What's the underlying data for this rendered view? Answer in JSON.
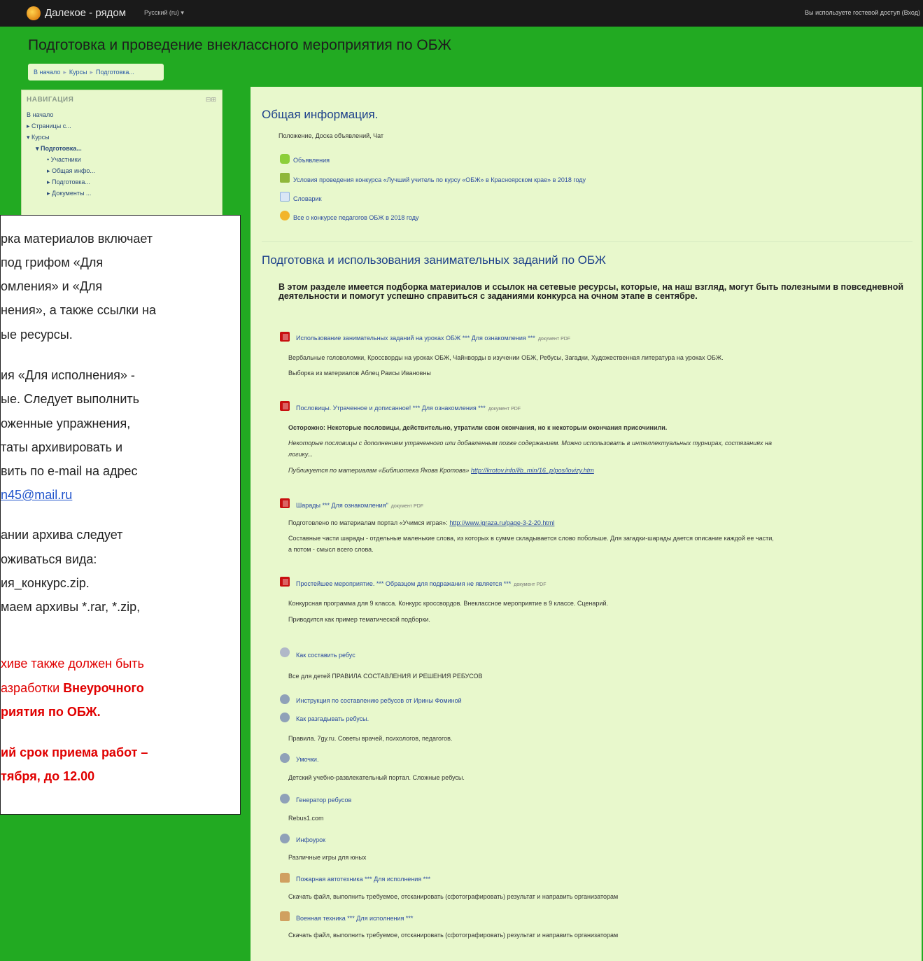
{
  "topbar": {
    "site_name": "Далекое - рядом",
    "language": "Русский (ru) ▾",
    "guest_notice": "Вы используете гостевой доступ (Вход)"
  },
  "header": {
    "title": "Подготовка и проведение внеклассного мероприятия по ОБЖ",
    "breadcrumb": [
      "В начало",
      "Курсы",
      "Подготовка..."
    ]
  },
  "nav": {
    "heading": "НАВИГАЦИЯ",
    "control": "⊟⊞",
    "items": [
      "В начало",
      "▸ Страницы с...",
      "▾ Курсы",
      "▾ Подготовка...",
      "• Участники",
      "▸ Общая инфо...",
      "▸ Подготовка...",
      "▸ Документы ..."
    ]
  },
  "section1": {
    "title": "Общая информация.",
    "summary": "Положение, Доска объявлений, Чат",
    "links": [
      {
        "label": "Объявления",
        "icon": "forum-icon"
      },
      {
        "label": "Условия проведения конкурса «Лучший учитель по курсу «ОБЖ» в Красноярском крае» в 2018 году",
        "icon": "book-icon"
      },
      {
        "label": "Словарик",
        "icon": "glossary-icon"
      },
      {
        "label": "Все о конкурсе педагогов ОБЖ в 2018 году",
        "icon": "chat-icon"
      }
    ]
  },
  "section2": {
    "title": "Подготовка и использования занимательных заданий по ОБЖ",
    "description": "В этом разделе имеется подборка материалов и ссылок на сетевые ресурсы, которые, на наш взгляд, могут быть полезными в повседневной деятельности и помогут успешно справиться с заданиями конкурса на очном этапе в сентябре.",
    "resources": [
      {
        "label": "Использование занимательных заданий на уроках ОБЖ *** Для ознакомления ***",
        "type": "документ PDF",
        "lines": [
          "Вербальные головоломки, Кроссворды на уроках ОБЖ, Чайнворды в изучении ОБЖ, Ребусы, Загадки, Художественная литература на уроках ОБЖ.",
          "Выборка из материалов Аблец Раисы Ивановны"
        ]
      },
      {
        "label": "Пословицы. Утраченное и дописанное! *** Для ознакомления ***",
        "type": "документ PDF",
        "lines": [
          "Осторожно: Некоторые пословицы, действительно, утратили свои окончания, но к некоторым окончания присочинили.",
          "Некоторые пословицы с дополнением утраченного или добавленным позже содержанием. Можно использовать в интеллектуальных турнирах, состязаниях на",
          "логику...",
          "Публикуется по материалам «Библиотека Якова Кротова»",
          "http://krotov.info/lib_min/16_p/pos/lovizy.htm"
        ]
      },
      {
        "label": "Шарады *** Для ознакомления\"",
        "type": "документ PDF",
        "lines": [
          "Подготовлено по материалам портал «Учимся играя»:",
          "http://www.igraza.ru/page-3-2-20.html",
          "Составные части шарады - отдельные маленькие слова, из которых в сумме складывается слово побольше. Для загадки-шарады дается описание каждой ее части,",
          "а потом - смысл всего слова."
        ]
      },
      {
        "label": "Простейшее мероприятие. *** Образцом для подражания не является ***",
        "type": "документ PDF",
        "lines": [
          "Конкурсная программа для 9 класса. Конкурс кроссвордов. Внеклассное мероприятие в 9 классе. Сценарий.",
          "Приводится как пример тематической подборки."
        ]
      },
      {
        "label": "Как составить ребус",
        "lines": [
          "Все для детей ПРАВИЛА СОСТАВЛЕНИЯ И РЕШЕНИЯ РЕБУСОВ"
        ]
      },
      {
        "label": "Инструкция по составлению ребусов от Ирины Фоминой",
        "lines": []
      },
      {
        "label": "Как разгадывать ребусы.",
        "lines": [
          "Правила. 7gy.ru. Советы врачей, психологов, педагогов."
        ]
      },
      {
        "label": "Умочки.",
        "lines": [
          "Детский учебно-развлекательный портал. Сложные ребусы."
        ]
      },
      {
        "label": "Генератор ребусов",
        "lines": [
          "Rebus1.com"
        ]
      },
      {
        "label": "Инфоурок",
        "lines": [
          "Различные игры для юных"
        ]
      },
      {
        "label": "Пожарная автотехника *** Для исполнения ***",
        "lines": [
          "Скачать файл, выполнить требуемое, отсканировать (сфотографировать) результат и направить организаторам"
        ]
      },
      {
        "label": "Военная техника *** Для исполнения ***",
        "lines": [
          "Скачать файл, выполнить требуемое, отсканировать (сфотографировать) результат и направить организаторам"
        ]
      }
    ]
  },
  "popup": {
    "lines": [
      "рка материалов включает",
      "под грифом «Для",
      "омления» и «Для",
      "нения», а также ссылки на",
      "ые ресурсы.",
      "ия «Для исполнения» -",
      "ые. Следует выполнить",
      "оженные упражнения,",
      "таты архивировать и",
      "вить по e-mail на адрес",
      "n45@mail.ru",
      "ании архива следует",
      "оживаться вида:",
      "ия_конкурс.zip.",
      "маем архивы *.rar, *.zip,",
      "хиве также должен быть",
      "азработки ",
      "Внеурочного",
      "риятия по ОБЖ.",
      "ий срок приема работ –",
      "тября, до 12.00"
    ]
  },
  "colors": {
    "header_green": "#22aa22",
    "panel_bg": "#e8f8cc",
    "link_blue": "#2a4aa0",
    "alert_red": "#e00000"
  }
}
